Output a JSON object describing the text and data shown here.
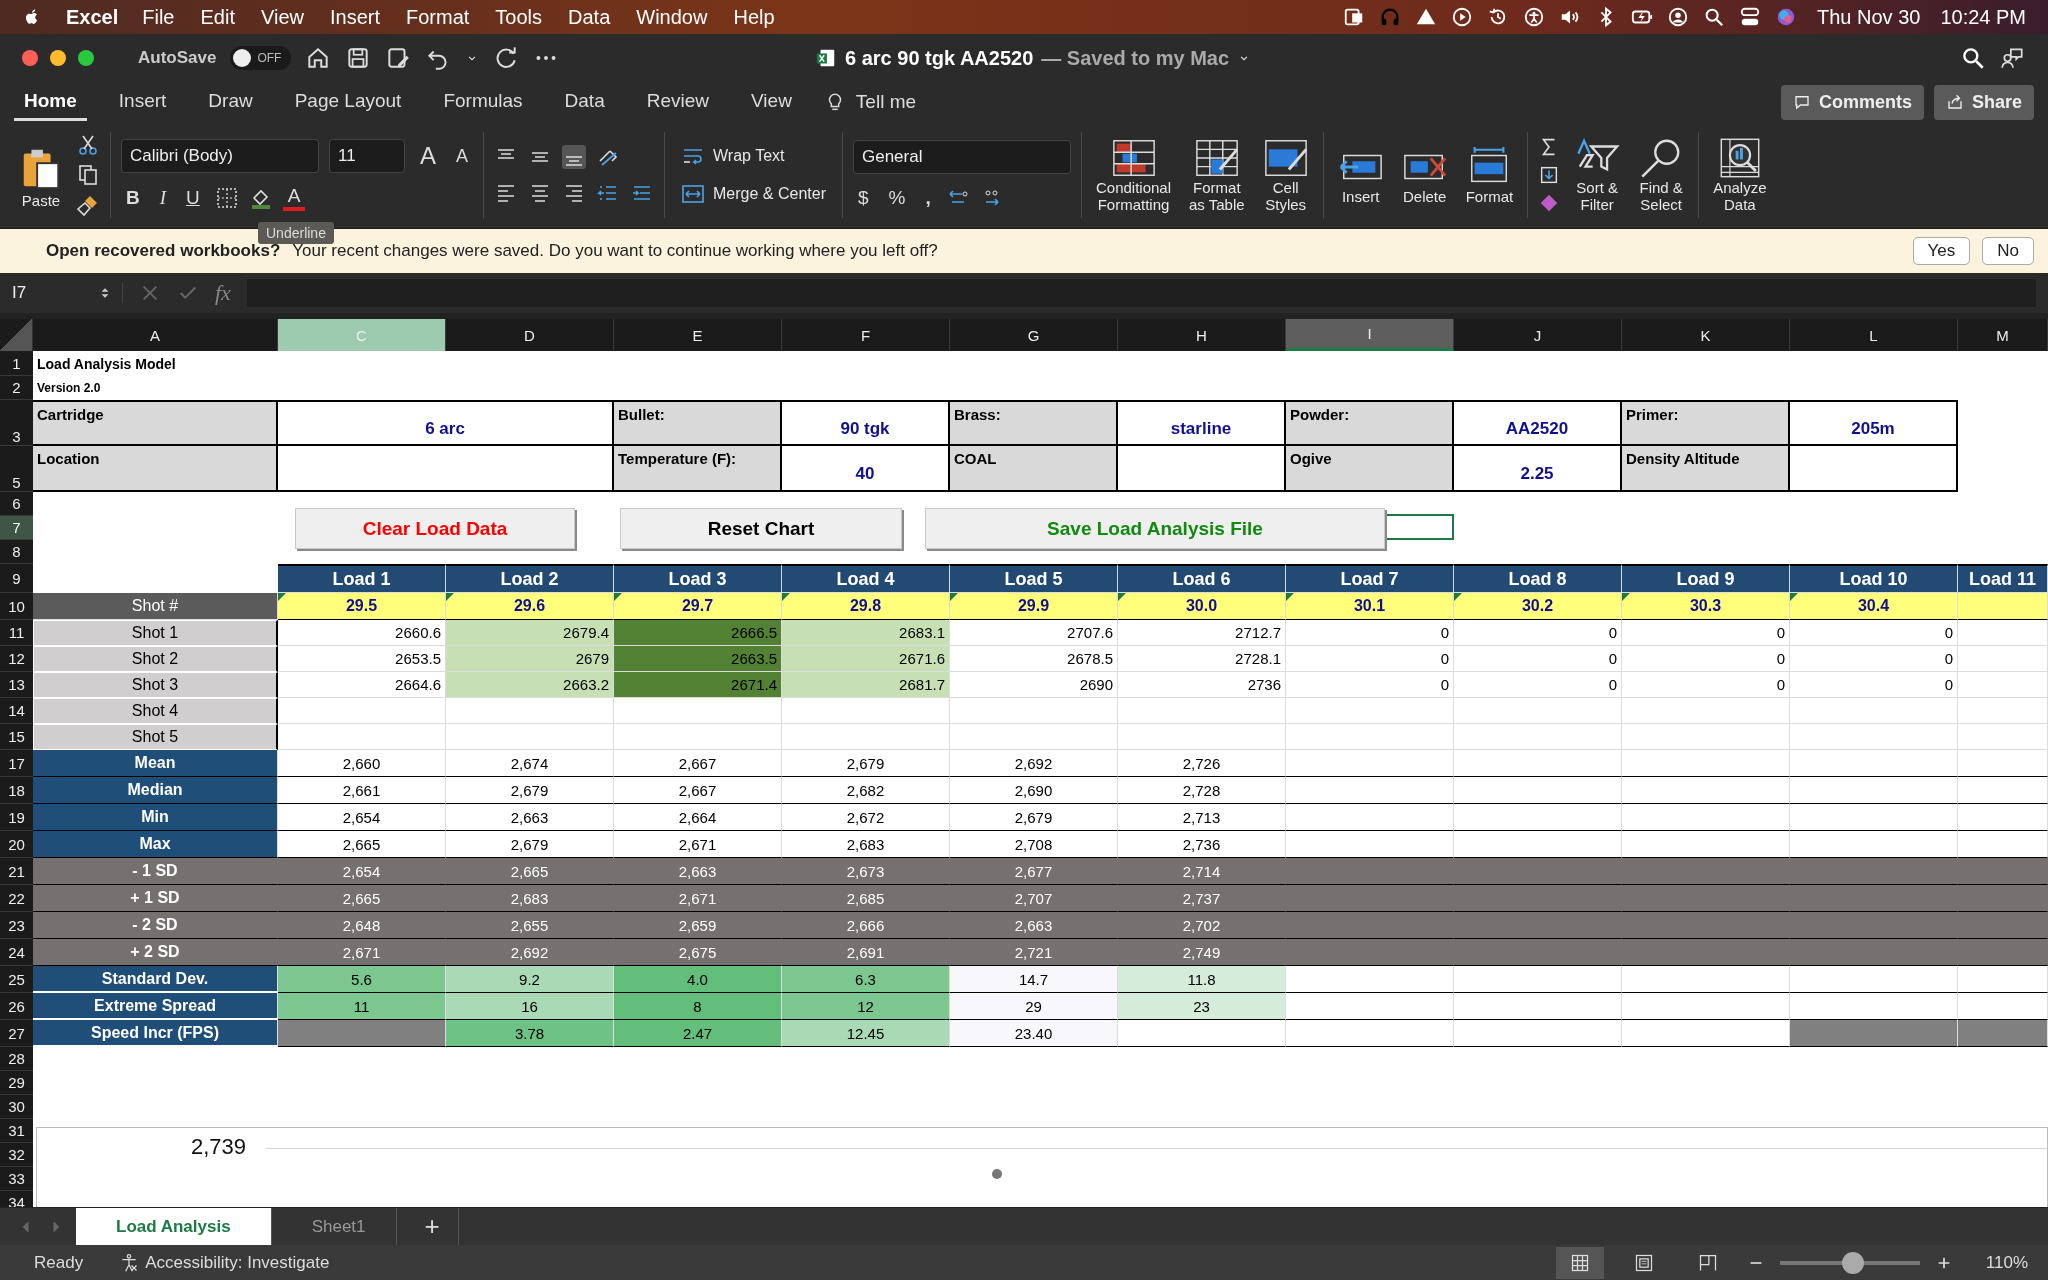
{
  "menubar": {
    "app": "Excel",
    "items": [
      "File",
      "Edit",
      "View",
      "Insert",
      "Format",
      "Tools",
      "Data",
      "Window",
      "Help"
    ],
    "date": "Thu Nov 30",
    "time": "10:24 PM"
  },
  "titlebar": {
    "autosave": "AutoSave",
    "autosave_toggle": {
      "label": "OFF",
      "on": false
    },
    "title": "6 arc 90 tgk AA2520",
    "status": "— Saved to my Mac"
  },
  "ribbon_tabs": [
    {
      "label": "Home",
      "selected": true
    },
    {
      "label": "Insert",
      "selected": false
    },
    {
      "label": "Draw",
      "selected": false
    },
    {
      "label": "Page Layout",
      "selected": false
    },
    {
      "label": "Formulas",
      "selected": false
    },
    {
      "label": "Data",
      "selected": false
    },
    {
      "label": "Review",
      "selected": false
    },
    {
      "label": "View",
      "selected": false
    }
  ],
  "tell_me": "Tell me",
  "comments": "Comments",
  "share": "Share",
  "ribbon": {
    "paste": "Paste",
    "font": "Calibri (Body)",
    "size": "11",
    "grow": "A",
    "shrink": "A",
    "bold": "B",
    "italic": "I",
    "underline": "U",
    "font_color": "A",
    "tooltip": "Underline",
    "wrap_text": "Wrap Text",
    "merge": "Merge & Center",
    "number_format": "General",
    "currency": "$",
    "percent": "%",
    "comma": ",",
    "commands": [
      {
        "kind": "conditional",
        "label_lines": [
          "Conditional",
          "Formatting"
        ]
      },
      {
        "kind": "table",
        "label_lines": [
          "Format",
          "as Table"
        ]
      },
      {
        "kind": "styles",
        "label_lines": [
          "Cell",
          "Styles"
        ]
      },
      {
        "kind": "insert",
        "label_lines": [
          "Insert"
        ]
      },
      {
        "kind": "delete",
        "label_lines": [
          "Delete"
        ]
      },
      {
        "kind": "format",
        "label_lines": [
          "Format"
        ]
      },
      {
        "kind": "sort",
        "label_lines": [
          "Sort &",
          "Filter"
        ]
      },
      {
        "kind": "find",
        "label_lines": [
          "Find &",
          "Select"
        ]
      },
      {
        "kind": "analyze",
        "label_lines": [
          "Analyze",
          "Data"
        ]
      }
    ]
  },
  "notification": {
    "title": "Open recovered workbooks?",
    "message": "Your recent changes were saved. Do you want to continue working where you left off?",
    "buttons": [
      "Yes",
      "No"
    ]
  },
  "formula_bar": {
    "name_box": "I7",
    "fx": "fx"
  },
  "sheet": {
    "columns": [
      {
        "label": "A",
        "selected": false,
        "shaded": false
      },
      {
        "label": "C",
        "selected": false,
        "shaded": true
      },
      {
        "label": "D",
        "selected": false,
        "shaded": false
      },
      {
        "label": "E",
        "selected": false,
        "shaded": false
      },
      {
        "label": "F",
        "selected": false,
        "shaded": false
      },
      {
        "label": "G",
        "selected": false,
        "shaded": false
      },
      {
        "label": "H",
        "selected": false,
        "shaded": false
      },
      {
        "label": "I",
        "selected": true,
        "shaded": false
      },
      {
        "label": "J",
        "selected": false,
        "shaded": false
      },
      {
        "label": "K",
        "selected": false,
        "shaded": false
      },
      {
        "label": "L",
        "selected": false,
        "shaded": false
      },
      {
        "label": "M",
        "selected": false,
        "shaded": false
      }
    ],
    "rows": [
      {
        "kind": "title",
        "row": "1",
        "selected": false,
        "text": "Load Analysis Model"
      },
      {
        "kind": "subtitle",
        "row": "2",
        "selected": false,
        "text": "Version 2.0"
      },
      {
        "kind": "info",
        "row": "3",
        "selected": false,
        "fields": [
          {
            "label": "Cartridge",
            "value": "6 arc"
          },
          {
            "label": "Bullet:",
            "value": "90 tgk"
          },
          {
            "label": "Brass:",
            "value": "starline"
          },
          {
            "label": "Powder:",
            "value": "AA2520"
          },
          {
            "label": "Primer:",
            "value": "205m"
          }
        ]
      },
      {
        "kind": "info",
        "row": "5",
        "selected": false,
        "fields": [
          {
            "label": "Location"
          },
          {
            "label": "Temperature (F):",
            "value": "40"
          },
          {
            "label": "COAL"
          },
          {
            "label": "Ogive",
            "value": "2.25"
          },
          {
            "label": "Density Altitude"
          }
        ]
      },
      {
        "kind": "empty",
        "row": "6",
        "selected": false
      },
      {
        "kind": "empty",
        "row": "7",
        "selected": true
      },
      {
        "kind": "empty",
        "row": "8",
        "selected": false
      },
      {
        "kind": "loads",
        "row": "9",
        "selected": false,
        "loads": [
          "Load 1",
          "Load 2",
          "Load 3",
          "Load 4",
          "Load 5",
          "Load 6",
          "Load 7",
          "Load 8",
          "Load 9",
          "Load 10",
          "Load 11"
        ]
      },
      {
        "kind": "charges",
        "row": "10",
        "selected": false,
        "label": "Shot #",
        "values": [
          "29.5",
          "29.6",
          "29.7",
          "29.8",
          "29.9",
          "30.0",
          "30.1",
          "30.2",
          "30.3",
          "30.4"
        ]
      },
      {
        "kind": "shots",
        "row": "11",
        "selected": false,
        "label": "Shot 1",
        "cells": [
          {
            "text": "2660.6",
            "color": "#ffffff"
          },
          {
            "text": "2679.4",
            "color": "#c6e0b4"
          },
          {
            "text": "2666.5",
            "color": "#548235"
          },
          {
            "text": "2683.1",
            "color": "#c6e0b4"
          },
          {
            "text": "2707.6",
            "color": "#ffffff"
          },
          {
            "text": "2712.7",
            "color": "#ffffff"
          },
          {
            "text": "0",
            "color": "#ffffff"
          },
          {
            "text": "0",
            "color": "#ffffff"
          },
          {
            "text": "0",
            "color": "#ffffff"
          },
          {
            "text": "0",
            "color": "#ffffff"
          }
        ]
      },
      {
        "kind": "shots",
        "row": "12",
        "selected": false,
        "label": "Shot 2",
        "cells": [
          {
            "text": "2653.5",
            "color": "#ffffff"
          },
          {
            "text": "2679",
            "color": "#c6e0b4"
          },
          {
            "text": "2663.5",
            "color": "#548235"
          },
          {
            "text": "2671.6",
            "color": "#c6e0b4"
          },
          {
            "text": "2678.5",
            "color": "#ffffff"
          },
          {
            "text": "2728.1",
            "color": "#ffffff"
          },
          {
            "text": "0",
            "color": "#ffffff"
          },
          {
            "text": "0",
            "color": "#ffffff"
          },
          {
            "text": "0",
            "color": "#ffffff"
          },
          {
            "text": "0",
            "color": "#ffffff"
          }
        ]
      },
      {
        "kind": "shots",
        "row": "13",
        "selected": false,
        "label": "Shot 3",
        "cells": [
          {
            "text": "2664.6",
            "color": "#ffffff"
          },
          {
            "text": "2663.2",
            "color": "#c6e0b4"
          },
          {
            "text": "2671.4",
            "color": "#548235"
          },
          {
            "text": "2681.7",
            "color": "#c6e0b4"
          },
          {
            "text": "2690",
            "color": "#ffffff"
          },
          {
            "text": "2736",
            "color": "#ffffff"
          },
          {
            "text": "0",
            "color": "#ffffff"
          },
          {
            "text": "0",
            "color": "#ffffff"
          },
          {
            "text": "0",
            "color": "#ffffff"
          },
          {
            "text": "0",
            "color": "#ffffff"
          }
        ]
      },
      {
        "kind": "shots",
        "row": "14",
        "selected": false,
        "label": "Shot 4"
      },
      {
        "kind": "shots",
        "row": "15",
        "selected": false,
        "label": "Shot 5"
      },
      {
        "kind": "stat",
        "row": "17",
        "selected": false,
        "label": "Mean",
        "values": [
          "2,660",
          "2,674",
          "2,667",
          "2,679",
          "2,692",
          "2,726"
        ]
      },
      {
        "kind": "stat",
        "row": "18",
        "selected": false,
        "label": "Median",
        "values": [
          "2,661",
          "2,679",
          "2,667",
          "2,682",
          "2,690",
          "2,728"
        ]
      },
      {
        "kind": "stat",
        "row": "19",
        "selected": false,
        "label": "Min",
        "values": [
          "2,654",
          "2,663",
          "2,664",
          "2,672",
          "2,679",
          "2,713"
        ]
      },
      {
        "kind": "stat",
        "row": "20",
        "selected": false,
        "label": "Max",
        "values": [
          "2,665",
          "2,679",
          "2,671",
          "2,683",
          "2,708",
          "2,736"
        ]
      },
      {
        "kind": "band",
        "row": "21",
        "selected": false,
        "label": "- 1 SD",
        "values": [
          "2,654",
          "2,665",
          "2,663",
          "2,673",
          "2,677",
          "2,714"
        ]
      },
      {
        "kind": "band",
        "row": "22",
        "selected": false,
        "label": "+ 1 SD",
        "values": [
          "2,665",
          "2,683",
          "2,671",
          "2,685",
          "2,707",
          "2,737"
        ]
      },
      {
        "kind": "band",
        "row": "23",
        "selected": false,
        "label": "- 2 SD",
        "values": [
          "2,648",
          "2,655",
          "2,659",
          "2,666",
          "2,663",
          "2,702"
        ]
      },
      {
        "kind": "band",
        "row": "24",
        "selected": false,
        "label": "+ 2 SD",
        "values": [
          "2,671",
          "2,692",
          "2,675",
          "2,691",
          "2,721",
          "2,749"
        ]
      },
      {
        "kind": "metric",
        "row": "25",
        "selected": false,
        "label": "Standard Dev.",
        "cells": [
          {
            "text": "5.6",
            "color": "#7cc790"
          },
          {
            "text": "9.2",
            "color": "#a9dab5"
          },
          {
            "text": "4.0",
            "color": "#63be7b"
          },
          {
            "text": "6.3",
            "color": "#7cc790"
          },
          {
            "text": "14.7",
            "color": "#f8f8fc"
          },
          {
            "text": "11.8",
            "color": "#d4ecd9"
          },
          {
            "color": "#ffffff"
          },
          {
            "color": "#ffffff"
          },
          {
            "color": "#ffffff"
          },
          {
            "color": "#ffffff"
          },
          {
            "color": "#ffffff"
          }
        ]
      },
      {
        "kind": "metric",
        "row": "26",
        "selected": false,
        "label": "Extreme Spread",
        "cells": [
          {
            "text": "11",
            "color": "#7cc790"
          },
          {
            "text": "16",
            "color": "#a9dab5"
          },
          {
            "text": "8",
            "color": "#63be7b"
          },
          {
            "text": "12",
            "color": "#7cc790"
          },
          {
            "text": "29",
            "color": "#f8f8fc"
          },
          {
            "text": "23",
            "color": "#d4ecd9"
          },
          {
            "color": "#ffffff"
          },
          {
            "color": "#ffffff"
          },
          {
            "color": "#ffffff"
          },
          {
            "color": "#ffffff"
          },
          {
            "color": "#ffffff"
          }
        ]
      },
      {
        "kind": "metric",
        "row": "27",
        "selected": false,
        "label": "Speed Incr (FPS)",
        "cells": [
          {
            "color": "#808080"
          },
          {
            "text": "3.78",
            "color": "#6dc285"
          },
          {
            "text": "2.47",
            "color": "#63be7b"
          },
          {
            "text": "12.45",
            "color": "#a9dab5"
          },
          {
            "text": "23.40",
            "color": "#f8f8fc"
          },
          {
            "color": "#ffffff"
          },
          {
            "color": "#ffffff"
          },
          {
            "color": "#ffffff"
          },
          {
            "color": "#ffffff"
          },
          {
            "color": "#808080"
          },
          {
            "color": "#808080"
          }
        ]
      },
      {
        "kind": "empty",
        "row": "28",
        "selected": false
      },
      {
        "kind": "empty",
        "row": "29",
        "selected": false
      },
      {
        "kind": "empty",
        "row": "30",
        "selected": false
      },
      {
        "kind": "empty",
        "row": "31",
        "selected": false
      },
      {
        "kind": "empty",
        "row": "32",
        "selected": false
      },
      {
        "kind": "empty",
        "row": "33",
        "selected": false
      },
      {
        "kind": "empty",
        "row": "34",
        "selected": false
      }
    ],
    "buttons": [
      {
        "label": "Clear Load Data",
        "kind": "danger"
      },
      {
        "label": "Reset Chart",
        "kind": "plain"
      },
      {
        "label": "Save Load Analysis File",
        "kind": "success"
      }
    ],
    "chart": {
      "axis_label": "2,739"
    }
  },
  "sheet_tabs": [
    {
      "label": "Load Analysis",
      "selected": true
    },
    {
      "label": "Sheet1",
      "selected": false
    }
  ],
  "add_sheet": "+",
  "status_bar": {
    "status": "Ready",
    "accessibility": "Accessibility: Investigate",
    "views": [
      {
        "kind": "normal",
        "selected": true
      },
      {
        "kind": "page-layout",
        "selected": false
      },
      {
        "kind": "page-break",
        "selected": false
      }
    ],
    "zoom_slider": {
      "level": 0.52
    },
    "zoom": "110%"
  }
}
